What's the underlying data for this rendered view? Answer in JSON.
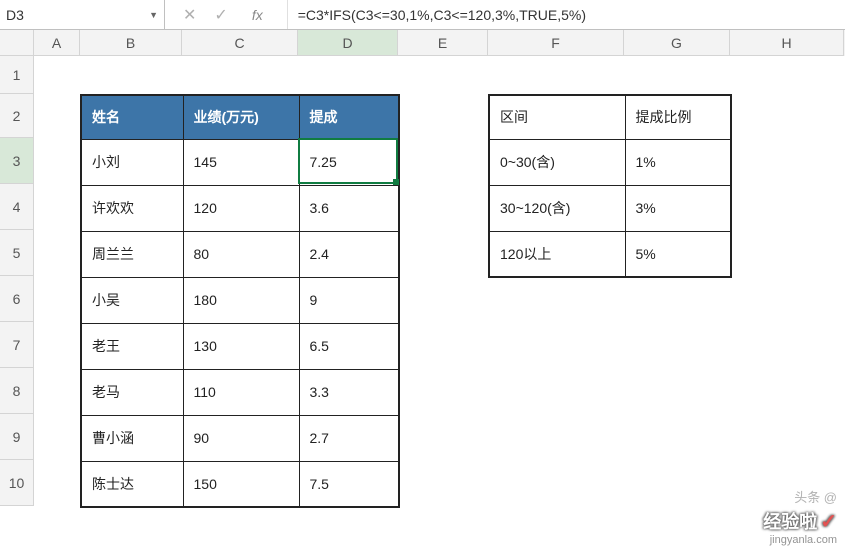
{
  "namebox": "D3",
  "fx_label": "fx",
  "formula": "=C3*IFS(C3<=30,1%,C3<=120,3%,TRUE,5%)",
  "columns": [
    "A",
    "B",
    "C",
    "D",
    "E",
    "F",
    "G",
    "H"
  ],
  "rows": [
    "1",
    "2",
    "3",
    "4",
    "5",
    "6",
    "7",
    "8",
    "9",
    "10"
  ],
  "data_table": {
    "headers": [
      "姓名",
      "业绩(万元)",
      "提成"
    ],
    "rows": [
      [
        "小刘",
        "145",
        "7.25"
      ],
      [
        "许欢欢",
        "120",
        "3.6"
      ],
      [
        "周兰兰",
        "80",
        "2.4"
      ],
      [
        "小吴",
        "180",
        "9"
      ],
      [
        "老王",
        "130",
        "6.5"
      ],
      [
        "老马",
        "110",
        "3.3"
      ],
      [
        "曹小涵",
        "90",
        "2.7"
      ],
      [
        "陈士达",
        "150",
        "7.5"
      ]
    ]
  },
  "ref_table": {
    "headers": [
      "区间",
      "提成比例"
    ],
    "rows": [
      [
        "0~30(含)",
        "1%"
      ],
      [
        "30~120(含)",
        "3%"
      ],
      [
        "120以上",
        "5%"
      ]
    ]
  },
  "watermark": {
    "author": "头条 @",
    "brand": "经验啦",
    "site": "jingyanla.com"
  }
}
